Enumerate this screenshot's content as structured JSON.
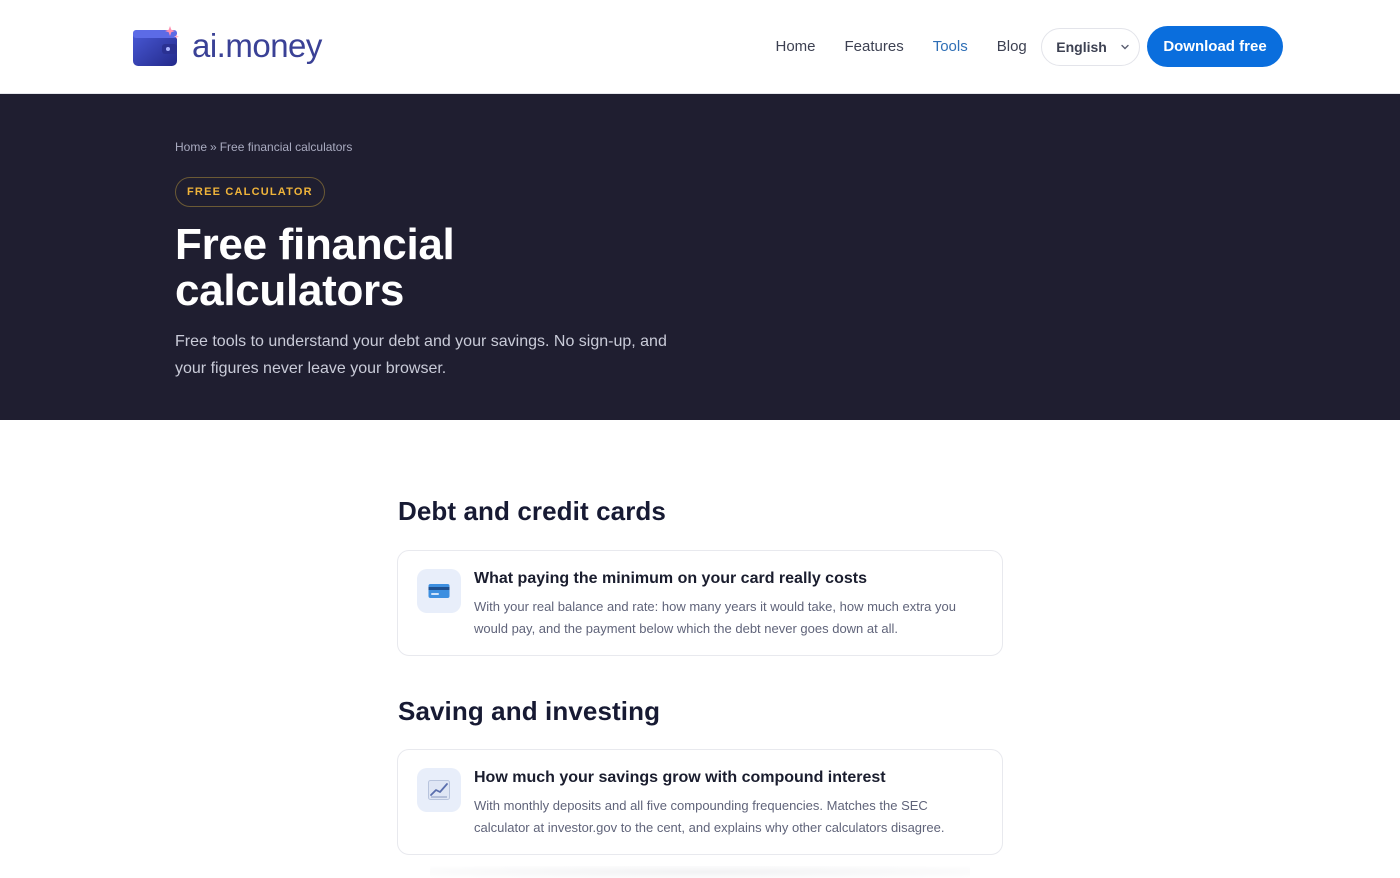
{
  "header": {
    "logo_text": "ai.money",
    "nav": [
      {
        "label": "Home",
        "active": false
      },
      {
        "label": "Features",
        "active": false
      },
      {
        "label": "Tools",
        "active": true
      },
      {
        "label": "Blog",
        "active": false
      }
    ],
    "language": "English",
    "download_label": "Download free"
  },
  "hero": {
    "breadcrumb_home": "Home",
    "breadcrumb_sep": "»",
    "breadcrumb_current": "Free financial calculators",
    "badge": "FREE CALCULATOR",
    "title": "Free financial calculators",
    "subtitle": "Free tools to understand your debt and your savings. No sign-up, and your figures never leave your browser."
  },
  "sections": [
    {
      "title": "Debt and credit cards",
      "cards": [
        {
          "icon": "credit-card-icon",
          "title": "What paying the minimum on your card really costs",
          "description": "With your real balance and rate: how many years it would take, how much extra you would pay, and the payment below which the debt never goes down at all."
        }
      ]
    },
    {
      "title": "Saving and investing",
      "cards": [
        {
          "icon": "chart-up-icon",
          "title": "How much your savings grow with compound interest",
          "description": "With monthly deposits and all five compounding frequencies. Matches the SEC calculator at investor.gov to the cent, and explains why other calculators disagree."
        }
      ]
    }
  ],
  "colors": {
    "hero_bg": "#1f1e30",
    "accent": "#0a6edd",
    "badge": "#f0b43a",
    "logo": "#3a4196"
  }
}
